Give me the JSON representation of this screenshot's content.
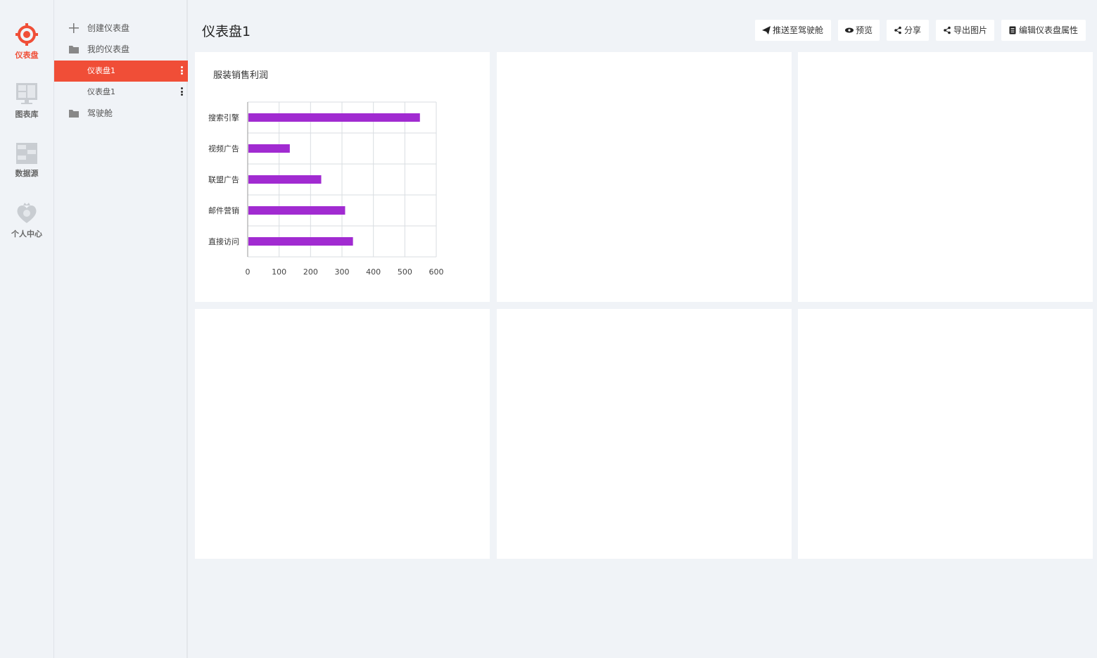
{
  "rail": {
    "items": [
      {
        "label": "仪表盘",
        "icon": "dashboard-icon"
      },
      {
        "label": "图表库",
        "icon": "chart-library-icon"
      },
      {
        "label": "数据源",
        "icon": "datasource-icon"
      },
      {
        "label": "个人中心",
        "icon": "personal-center-icon"
      }
    ]
  },
  "tree": {
    "create_label": "创建仪表盘",
    "my_dashboards_label": "我的仪表盘",
    "dashboard_items": [
      "仪表盘1",
      "仪表盘1"
    ],
    "cockpit_label": "驾驶舱"
  },
  "page": {
    "title": "仪表盘1"
  },
  "toolbar": {
    "push_label": "推送至驾驶舱",
    "preview_label": "预览",
    "share_label": "分享",
    "export_label": "导出图片",
    "edit_label": "编辑仪表盘属性"
  },
  "colors": {
    "accent": "#f04e37",
    "bar": "#a12bd1",
    "background": "#f0f3f7"
  },
  "chart_data": {
    "type": "bar",
    "orientation": "horizontal",
    "title": "服装销售利润",
    "categories": [
      "搜索引擎",
      "视频广告",
      "联盟广告",
      "邮件营销",
      "直接访问"
    ],
    "values": [
      548,
      134,
      234,
      310,
      335
    ],
    "xlim": [
      0,
      600
    ],
    "xticks": [
      0,
      100,
      200,
      300,
      400,
      500,
      600
    ],
    "grid": true,
    "legend": "none"
  }
}
